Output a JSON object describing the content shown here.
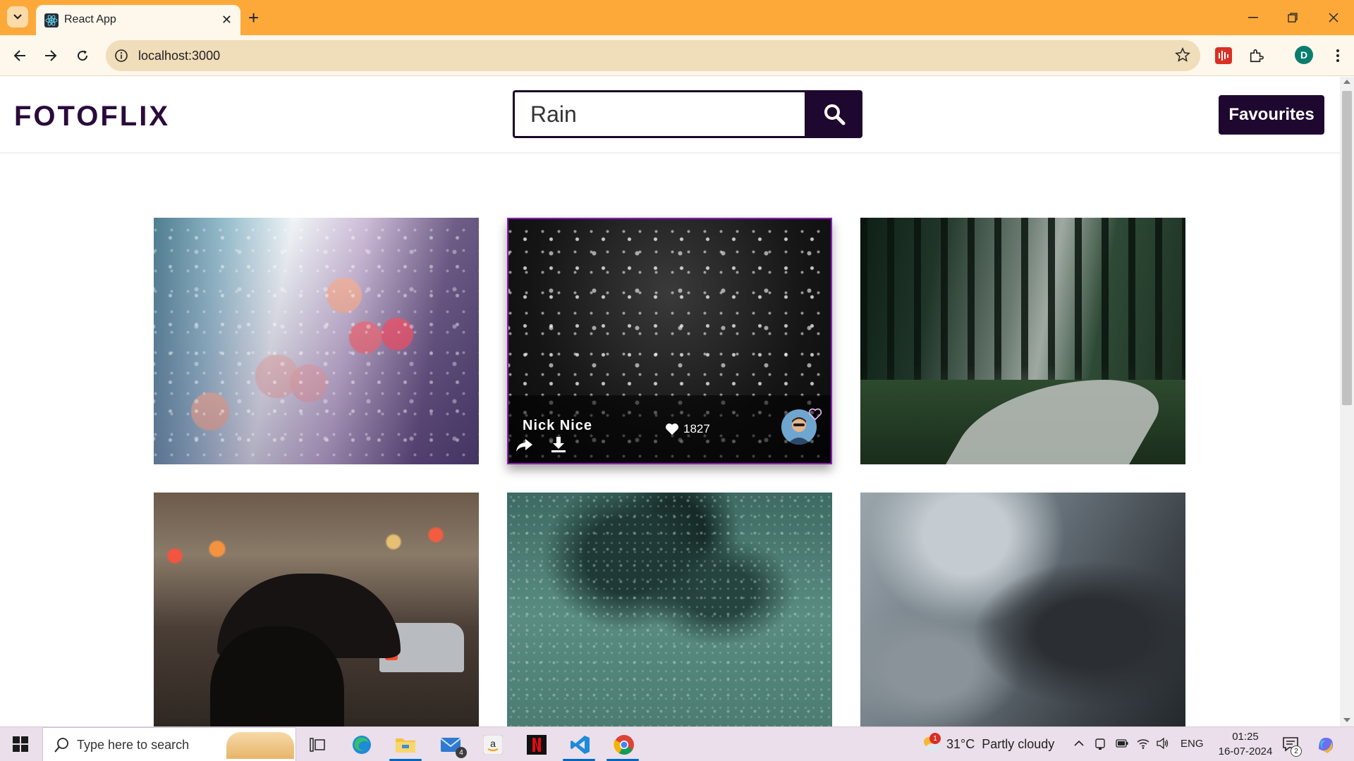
{
  "browser": {
    "tab_title": "React App",
    "url": "localhost:3000",
    "profile_initial": "D"
  },
  "app": {
    "logo": "FOTOFLIX",
    "search": {
      "value": "Rain",
      "placeholder": ""
    },
    "favourites_label": "Favourites"
  },
  "photos": [
    {
      "theme": "rain-on-window-bokeh"
    },
    {
      "theme": "raindrops-dark",
      "hovered": true,
      "author": "Nick Nice",
      "likes": "1827"
    },
    {
      "theme": "forest-road"
    },
    {
      "theme": "umbrella-city-street"
    },
    {
      "theme": "rainy-green-glass"
    },
    {
      "theme": "storm-clouds"
    }
  ],
  "taskbar": {
    "search_placeholder": "Type here to search",
    "mail_badge": "4",
    "weather_badge": "1",
    "temperature": "31°C",
    "weather_text": "Partly cloudy",
    "language": "ENG",
    "time": "01:25",
    "date": "16-07-2024",
    "notification_count": "2"
  },
  "colors": {
    "tab_bar": "#fda93a",
    "toolbar": "#fef7ec",
    "brand_dark": "#1f0830",
    "hover_border": "#8b1db6",
    "taskbar": "#eadfea"
  }
}
